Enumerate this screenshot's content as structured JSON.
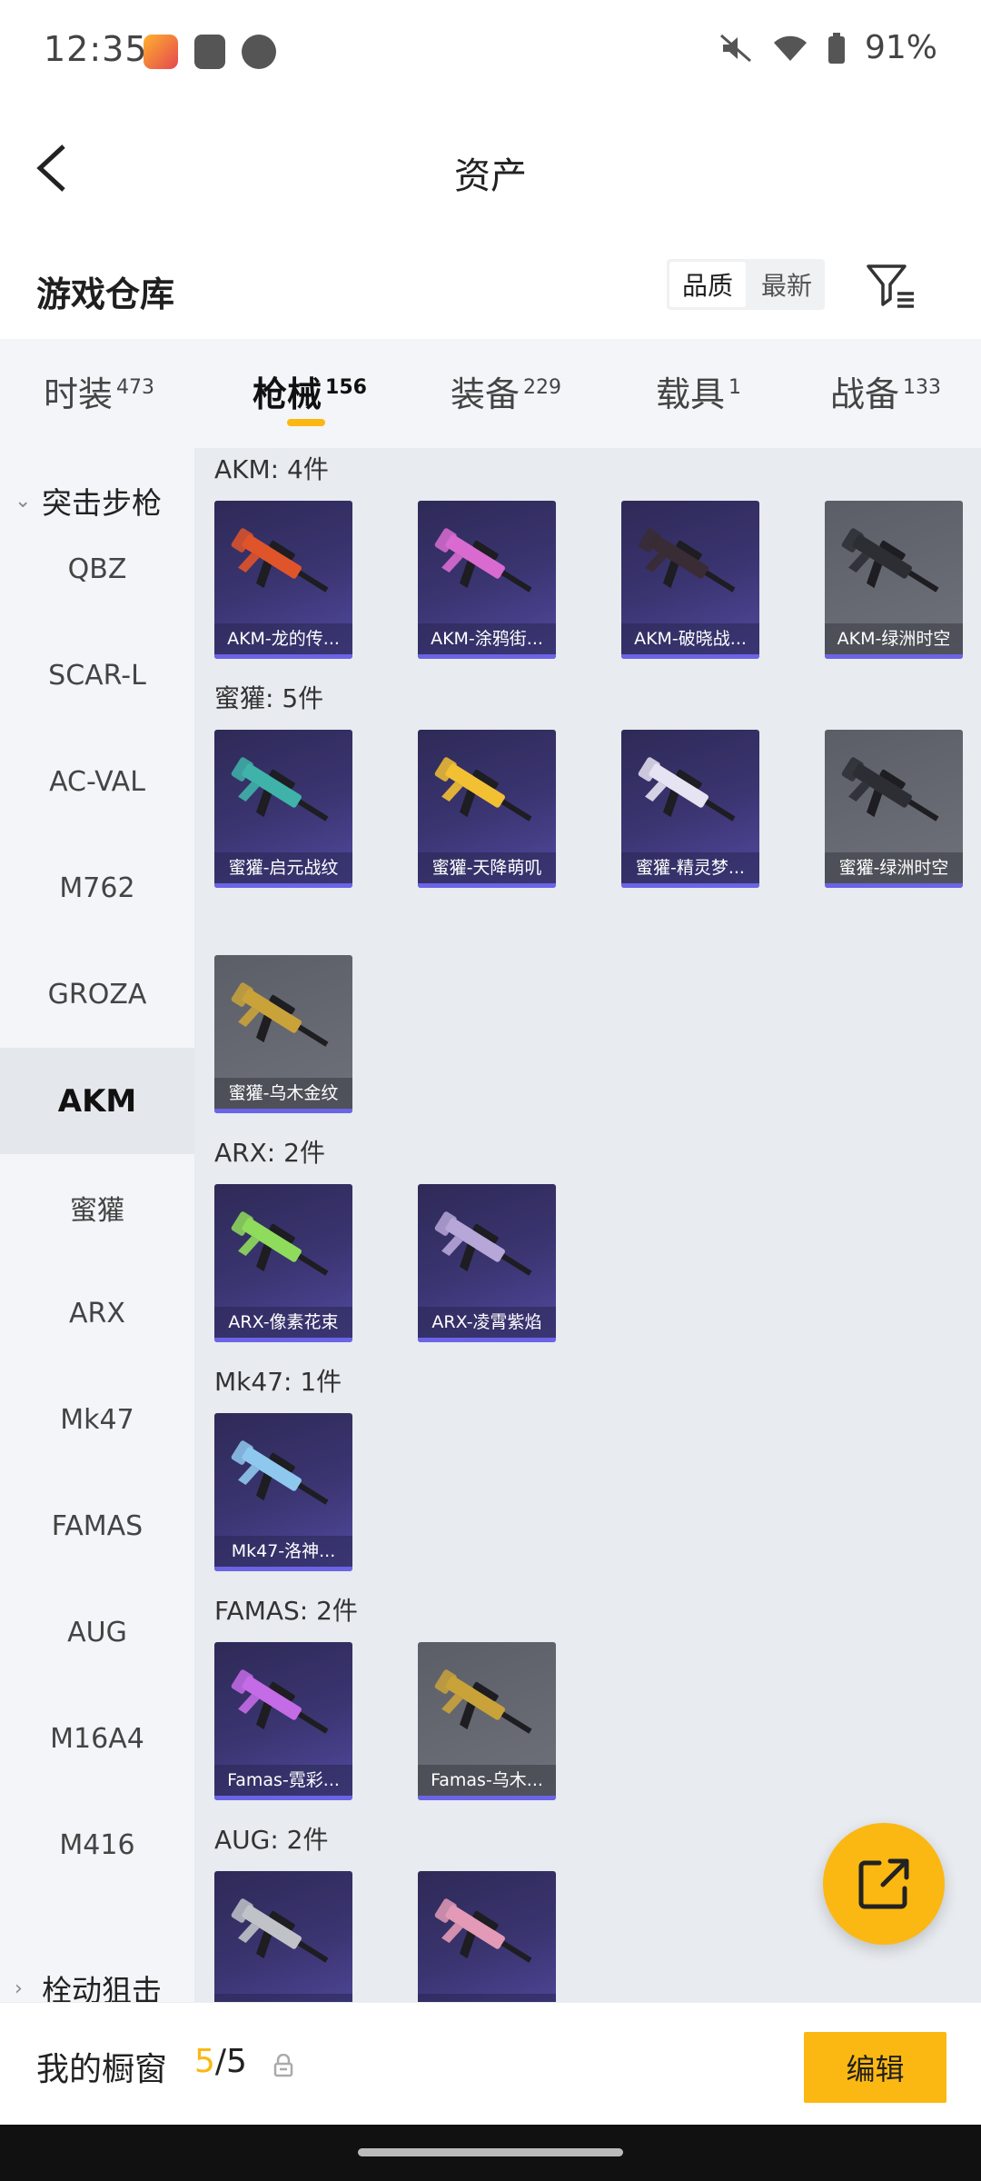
{
  "status_bar": {
    "time": "12:35",
    "battery": "91%"
  },
  "header": {
    "title": "资产"
  },
  "warehouse": {
    "title": "游戏仓库",
    "sort_options": [
      "品质",
      "最新"
    ],
    "active_sort": 0
  },
  "tabs": [
    {
      "label": "时装",
      "count": "473"
    },
    {
      "label": "枪械",
      "count": "156"
    },
    {
      "label": "装备",
      "count": "229"
    },
    {
      "label": "载具",
      "count": "1"
    },
    {
      "label": "战备",
      "count": "133"
    }
  ],
  "active_tab": 1,
  "sidebar": {
    "group_expanded": "突击步枪",
    "items": [
      "QBZ",
      "SCAR-L",
      "AC-VAL",
      "M762",
      "GROZA",
      "AKM",
      "蜜獾",
      "ARX",
      "Mk47",
      "FAMAS",
      "AUG",
      "M16A4",
      "M416"
    ],
    "active_item": "AKM",
    "group_collapsed": "栓动狙击"
  },
  "sections": [
    {
      "title": "AKM: 4件",
      "items": [
        {
          "name": "AKM-龙的传...",
          "style": "purple",
          "color": "#e0542a"
        },
        {
          "name": "AKM-涂鸦街...",
          "style": "purple",
          "color": "#d96bd0"
        },
        {
          "name": "AKM-破晓战...",
          "style": "purple",
          "color": "#3a2c34"
        },
        {
          "name": "AKM-绿洲时空",
          "style": "grey",
          "color": "#2c2e34"
        }
      ]
    },
    {
      "title": "蜜獾: 5件",
      "items": [
        {
          "name": "蜜獾-启元战纹",
          "style": "purple",
          "color": "#3fb3a9"
        },
        {
          "name": "蜜獾-天降萌叽",
          "style": "purple",
          "color": "#f2c033"
        },
        {
          "name": "蜜獾-精灵梦...",
          "style": "purple",
          "color": "#e6e3f2"
        },
        {
          "name": "蜜獾-绿洲时空",
          "style": "grey",
          "color": "#2c2e34"
        },
        {
          "name": "蜜獾-乌木金纹",
          "style": "grey",
          "color": "#c9a23a"
        }
      ]
    },
    {
      "title": "ARX: 2件",
      "items": [
        {
          "name": "ARX-像素花束",
          "style": "purple",
          "color": "#8fdc5c"
        },
        {
          "name": "ARX-凌霄紫焰",
          "style": "purple",
          "color": "#b7a6d8"
        }
      ]
    },
    {
      "title": "Mk47: 1件",
      "items": [
        {
          "name": "Mk47-洛神...",
          "style": "purple",
          "color": "#8fc8ee"
        }
      ]
    },
    {
      "title": "FAMAS: 2件",
      "items": [
        {
          "name": "Famas-霓彩...",
          "style": "purple",
          "color": "#c46be6"
        },
        {
          "name": "Famas-乌木...",
          "style": "grey",
          "color": "#c9a23a"
        }
      ]
    },
    {
      "title": "AUG: 2件",
      "items": [
        {
          "name": "",
          "style": "purple",
          "color": "#bfc3c8"
        },
        {
          "name": "",
          "style": "purple",
          "color": "#e39ab6"
        }
      ]
    }
  ],
  "bottom_bar": {
    "showcase_label": "我的橱窗",
    "showcase_current": "5",
    "showcase_total": "/5",
    "edit_label": "编辑"
  },
  "colors": {
    "accent": "#fbb812",
    "card_purple": "#3a3470",
    "card_grey": "#676a73",
    "card_bar": "#6b64e6"
  }
}
